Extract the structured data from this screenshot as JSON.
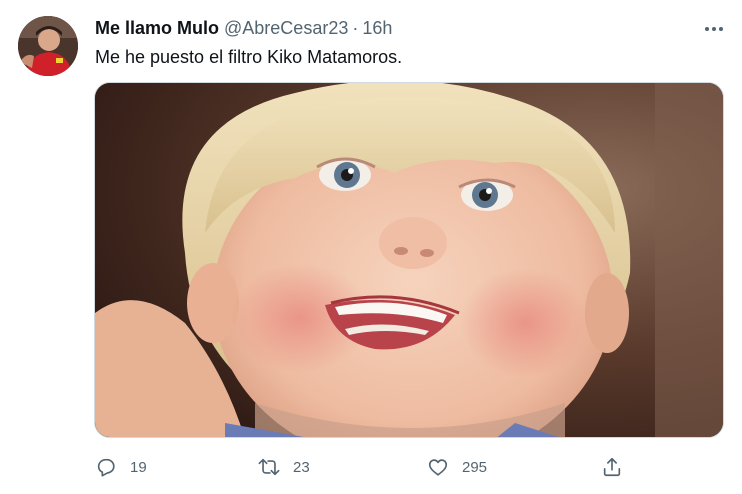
{
  "tweet": {
    "display_name": "Me llamo Mulo",
    "handle": "@AbreCesar23",
    "separator": "·",
    "time": "16h",
    "text": "Me he puesto el filtro Kiko Matamoros.",
    "more_icon": "more-horizontal-icon",
    "media": {
      "kind": "photo",
      "subject": "smiling toddler close-up"
    },
    "actions": {
      "reply": {
        "icon": "reply-icon",
        "count": "19"
      },
      "retweet": {
        "icon": "retweet-icon",
        "count": "23"
      },
      "like": {
        "icon": "heart-icon",
        "count": "295"
      },
      "share": {
        "icon": "share-icon",
        "count": ""
      }
    }
  },
  "colors": {
    "text_primary": "#0f1419",
    "text_secondary": "#536471",
    "border": "#cfd9de",
    "background": "#ffffff"
  }
}
